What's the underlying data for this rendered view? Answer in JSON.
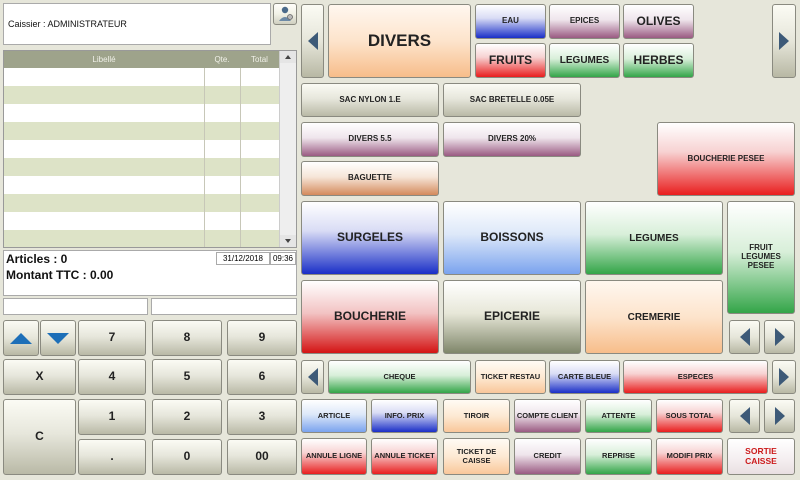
{
  "header": {
    "cashier_label": "Caissier : ADMINISTRATEUR"
  },
  "table": {
    "columns": [
      "Libellé",
      "Qte.",
      "Total"
    ]
  },
  "summary": {
    "articles": "Articles : 0",
    "date": "31/12/2018",
    "time": "09:36",
    "montant": "Montant TTC : 0.00"
  },
  "keypad": {
    "keys": [
      "7",
      "8",
      "9",
      "X",
      "4",
      "5",
      "6",
      "1",
      "2",
      "3",
      "C",
      ".",
      "0",
      "00"
    ]
  },
  "categories": {
    "main": "DIVERS",
    "items": [
      "EAU",
      "EPICES",
      "OLIVES",
      "FRUITS",
      "LEGUMES",
      "HERBES"
    ]
  },
  "products": {
    "sac_nylon": "SAC NYLON 1.E",
    "sac_bretelle": "SAC BRETELLE 0.05E",
    "divers55": "DIVERS 5.5",
    "divers20": "DIVERS 20%",
    "baguette": "BAGUETTE",
    "boucherie_pesee": "BOUCHERIE PESEE"
  },
  "families": {
    "surgeles": "SURGELES",
    "boissons": "BOISSONS",
    "legumes": "LEGUMES",
    "fruit_legumes_pesee": "FRUIT LEGUMES PESEE",
    "boucherie": "BOUCHERIE",
    "epicerie": "EPICERIE",
    "cremerie": "CREMERIE"
  },
  "payments": [
    "CHEQUE",
    "TICKET RESTAU",
    "CARTE BLEUE",
    "ESPECES"
  ],
  "actions": {
    "row1": [
      "ARTICLE",
      "INFO. PRIX",
      "TIROIR",
      "COMPTE CLIENT",
      "ATTENTE",
      "SOUS TOTAL"
    ],
    "row2": [
      "ANNULE LIGNE",
      "ANNULE TICKET",
      "TICKET DE CAISSE",
      "CREDIT",
      "REPRISE",
      "MODIFI PRIX",
      "SORTIE CAISSE"
    ]
  },
  "colors": {
    "sortie_text": "#cc1b1b",
    "arrow": "#3d5a78",
    "scroll_arrow": "#1d6fb8"
  }
}
